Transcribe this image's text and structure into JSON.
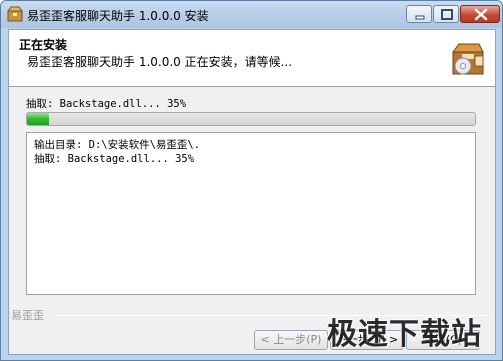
{
  "window": {
    "title": "易歪歪客服聊天助手 1.0.0.0 安装"
  },
  "header": {
    "title": "正在安装",
    "subtitle": "易歪歪客服聊天助手 1.0.0.0 正在安装，请等候..."
  },
  "progress": {
    "status": "抽取: Backstage.dll... 35%",
    "value": 0.05
  },
  "log": {
    "lines": [
      "输出目录: D:\\安装软件\\易歪歪\\.",
      "抽取: Backstage.dll... 35%"
    ]
  },
  "footer": {
    "brand": "易歪歪",
    "back_label": "< 上一步(P)",
    "next_label": "下一步(N) >",
    "cancel_label": "取消(C)"
  },
  "watermark": {
    "text": "极速下载站"
  },
  "icons": {
    "app": "installer-box-icon",
    "header": "package-disc-icon"
  },
  "colors": {
    "progress": "#2fb52f",
    "title_bar": "#bcd3ec",
    "close": "#c64b36"
  }
}
